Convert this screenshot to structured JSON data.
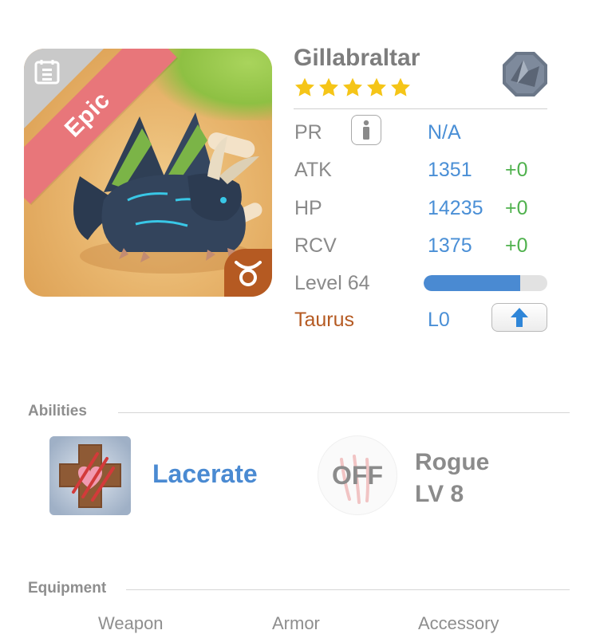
{
  "hero": {
    "name": "Gillabraltar",
    "rarity": "Epic",
    "stars": 5,
    "zodiac_symbol": "♉"
  },
  "stats": {
    "pr": {
      "label": "PR",
      "value": "N/A"
    },
    "atk": {
      "label": "ATK",
      "value": "1351",
      "bonus": "+0"
    },
    "hp": {
      "label": "HP",
      "value": "14235",
      "bonus": "+0"
    },
    "rcv": {
      "label": "RCV",
      "value": "1375",
      "bonus": "+0"
    },
    "level": {
      "label": "Level 64",
      "progress": 0.78
    },
    "zodiac": {
      "label": "Taurus",
      "value": "L0"
    }
  },
  "abilities": {
    "title": "Abilities",
    "skill_name": "Lacerate",
    "status": "OFF",
    "class_name": "Rogue",
    "class_level": "LV 8"
  },
  "equipment": {
    "title": "Equipment",
    "slots": [
      "Weapon",
      "Armor",
      "Accessory"
    ]
  },
  "icons": {
    "calendar": "calendar-icon",
    "element": "earth-element-icon",
    "info": "info-icon",
    "upgrade": "up-arrow-icon",
    "star": "star-icon"
  },
  "colors": {
    "blue": "#4a8ad2",
    "green": "#4fb14d",
    "gold": "#f5c518",
    "epic_ribbon": "#e8767a",
    "zodiac": "#b55a22"
  }
}
